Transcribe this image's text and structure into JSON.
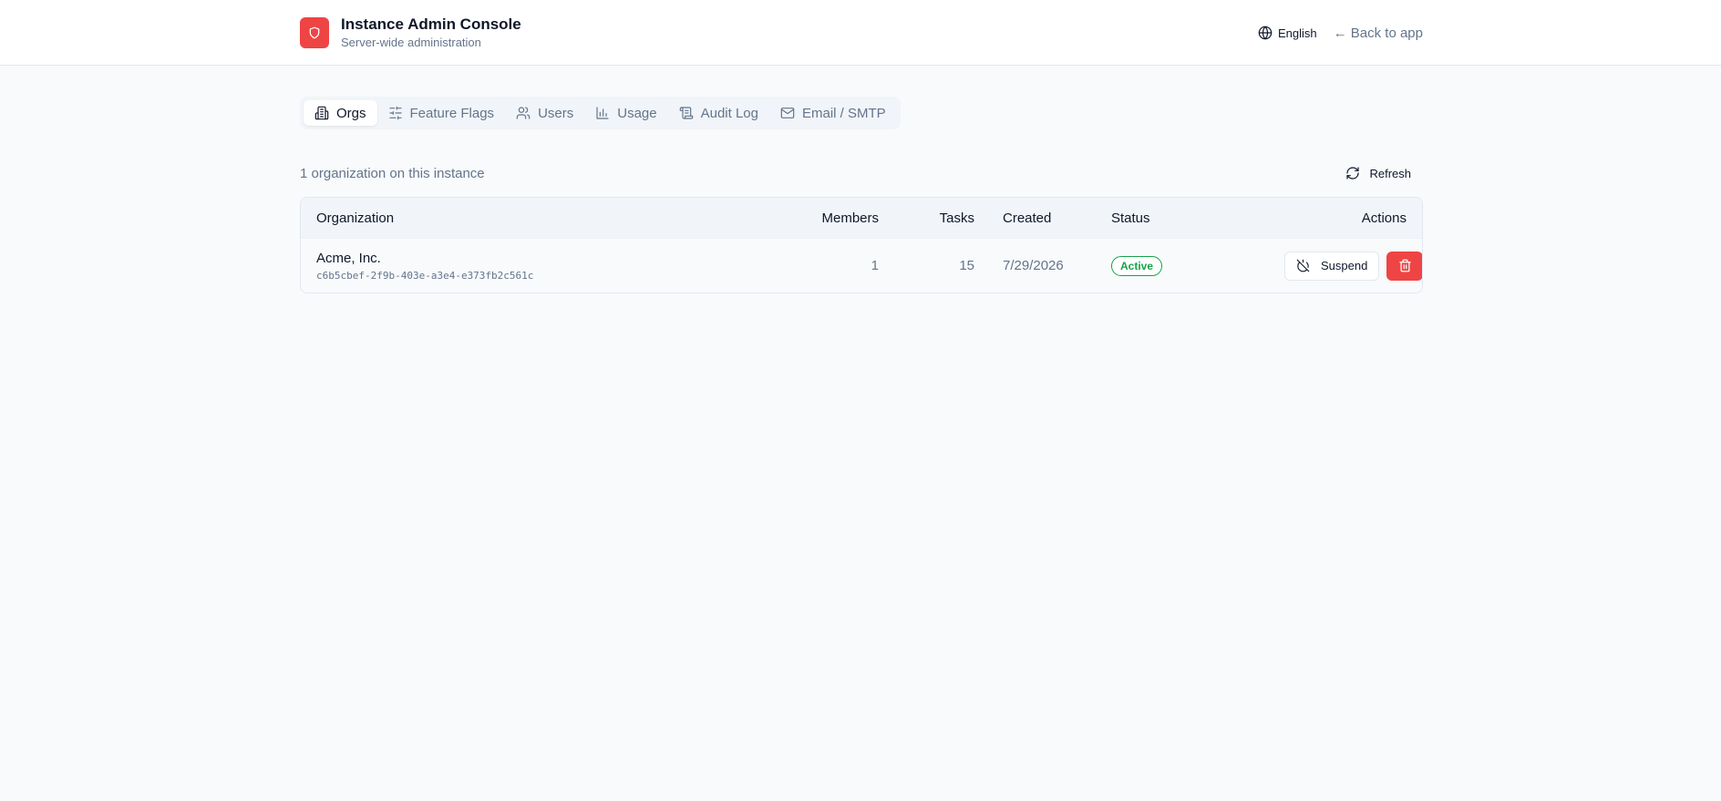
{
  "header": {
    "title": "Instance Admin Console",
    "subtitle": "Server-wide administration",
    "logo_icon": "shield-icon",
    "accent_color": "#ef4444",
    "language": "English",
    "back_link": "← Back to app"
  },
  "tabs": [
    {
      "label": "Orgs",
      "icon": "building-icon",
      "active": true
    },
    {
      "label": "Feature Flags",
      "icon": "sliders-icon",
      "active": false
    },
    {
      "label": "Users",
      "icon": "users-icon",
      "active": false
    },
    {
      "label": "Usage",
      "icon": "bar-chart-icon",
      "active": false
    },
    {
      "label": "Audit Log",
      "icon": "scroll-icon",
      "active": false
    },
    {
      "label": "Email / SMTP",
      "icon": "mail-icon",
      "active": false
    }
  ],
  "summary": "1 organization on this instance",
  "refresh_label": "Refresh",
  "table": {
    "headers": {
      "organization": "Organization",
      "members": "Members",
      "tasks": "Tasks",
      "created": "Created",
      "status": "Status",
      "actions": "Actions"
    },
    "rows": [
      {
        "name": "Acme, Inc.",
        "id": "c6b5cbef-2f9b-403e-a3e4-e373fb2c561c",
        "members": "1",
        "tasks": "15",
        "created": "7/29/2026",
        "status": "Active",
        "suspend_label": "Suspend"
      }
    ]
  }
}
